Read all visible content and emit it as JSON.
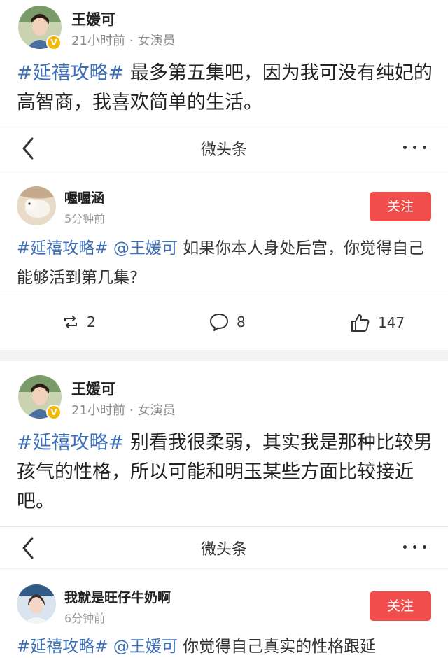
{
  "posts": [
    {
      "author": "王媛可",
      "time": "21小时前",
      "role": "女演员",
      "tag": "#延禧攻略#",
      "text": " 最多第五集吧，因为我可没有纯妃的高智商，我喜欢简单的生活。",
      "card": {
        "title": "微头条",
        "commenter": "喔喔涵",
        "comment_time": "5分钟前",
        "follow_label": "关注",
        "tag": "#延禧攻略#",
        "mention": " @王媛可",
        "text": " 如果你本人身处后宫，你觉得自己能够活到第几集?",
        "repost_count": "2",
        "comment_count": "8",
        "like_count": "147"
      }
    },
    {
      "author": "王媛可",
      "time": "21小时前",
      "role": "女演员",
      "tag": "#延禧攻略#",
      "text": " 别看我很柔弱，其实我是那种比较男孩气的性格，所以可能和明玉某些方面比较接近吧。",
      "card": {
        "title": "微头条",
        "commenter": "我就是旺仔牛奶啊",
        "comment_time": "6分钟前",
        "follow_label": "关注",
        "tag": "#延禧攻略#",
        "mention": " @王媛可",
        "text": " 你觉得自己真实的性格跟延"
      }
    }
  ],
  "colors": {
    "hashtag": "#3d6fb6",
    "follow": "#f24d4d",
    "verified_badge": "#f5b800"
  },
  "icons": {
    "back": "chevron-left-icon",
    "more": "more-dots-icon",
    "repost": "repost-icon",
    "comment": "comment-icon",
    "like": "thumbs-up-icon",
    "verified": "verified-v-icon"
  }
}
